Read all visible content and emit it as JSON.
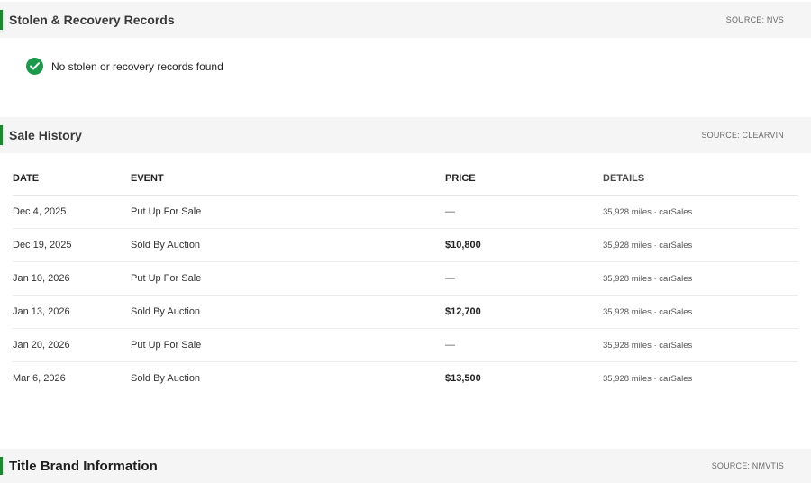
{
  "stolen": {
    "title": "Stolen & Recovery Records",
    "source": "SOURCE: NVS",
    "message": "No stolen or recovery records found",
    "status_color": "#1a9a4a"
  },
  "sale_history": {
    "title": "Sale History",
    "source": "SOURCE: CLEARVIN",
    "columns": {
      "date": "DATE",
      "event": "EVENT",
      "price": "PRICE",
      "details": "DETAILS"
    },
    "rows": [
      {
        "date": "Dec 4, 2025",
        "event": "Put Up For Sale",
        "price": "—",
        "details": "35,928 miles · carSales"
      },
      {
        "date": "Dec 19, 2025",
        "event": "Sold By Auction",
        "price": "$10,800",
        "details": "35,928 miles · carSales"
      },
      {
        "date": "Jan 10, 2026",
        "event": "Put Up For Sale",
        "price": "—",
        "details": "35,928 miles · carSales"
      },
      {
        "date": "Jan 13, 2026",
        "event": "Sold By Auction",
        "price": "$12,700",
        "details": "35,928 miles · carSales"
      },
      {
        "date": "Jan 20, 2026",
        "event": "Put Up For Sale",
        "price": "—",
        "details": "35,928 miles · carSales"
      },
      {
        "date": "Mar 6, 2026",
        "event": "Sold By Auction",
        "price": "$13,500",
        "details": "35,928 miles · carSales"
      }
    ]
  },
  "title_brand": {
    "title": "Title Brand Information",
    "source": "SOURCE: NMVTIS"
  },
  "accent_color": "#1a8a2e"
}
